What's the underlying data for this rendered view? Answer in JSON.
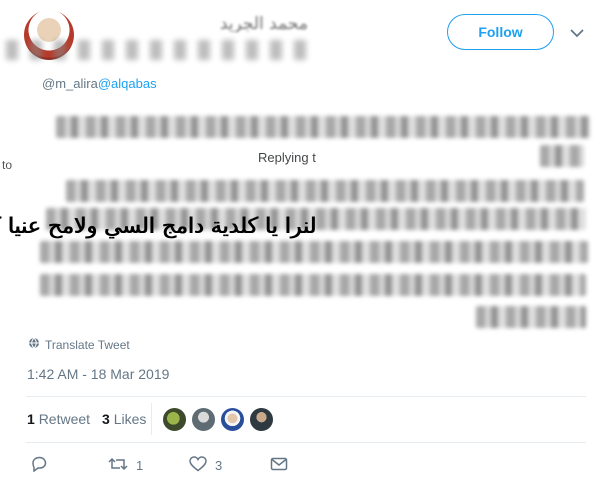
{
  "header": {
    "display_name": "محمد الجريد",
    "handle_fragment": "@m_alira",
    "mention": "@alqabas",
    "follow_label": "Follow",
    "chevron_icon": "chevron-down-icon",
    "accent_color": "#1da1f2"
  },
  "tweet": {
    "replying_right": "Replying t",
    "replying_left": "to",
    "overlay_text": "لنرا يا كلدية دامج السي ولامح عنيا كالا"
  },
  "meta": {
    "translate_label": "Translate Tweet",
    "timestamp": "1:42 AM - 18 Mar 2019",
    "retweet_count": "1",
    "retweet_label": "Retweet",
    "likes_count": "3",
    "likes_label": "Likes"
  },
  "actions": {
    "reply_icon": "reply-icon",
    "retweet_icon": "retweet-icon",
    "retweet_count": "1",
    "like_icon": "heart-icon",
    "like_count": "3",
    "dm_icon": "envelope-icon"
  }
}
